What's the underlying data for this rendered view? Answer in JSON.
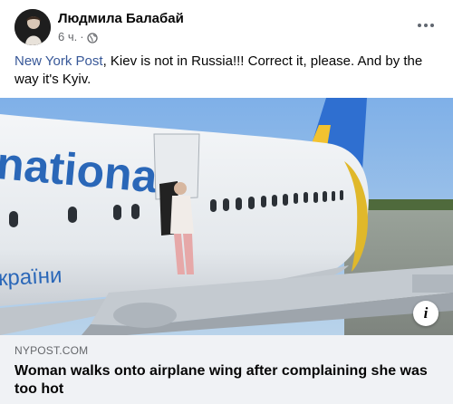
{
  "post": {
    "author": "Людмила Балабай",
    "time": "6 ч.",
    "separator": "·",
    "audience_icon": "globe-icon",
    "menu_icon": "more-options-icon",
    "text": {
      "link": "New York Post",
      "rest": ", Kiev is not in Russia!!! Correct it, please. And by the way it's Kyiv."
    }
  },
  "media": {
    "fuselage_text_top": "national",
    "fuselage_text_bottom": "країни",
    "info_icon": "info-icon",
    "info_label": "i"
  },
  "link_preview": {
    "domain": "NYPOST.COM",
    "headline": "Woman walks onto airplane wing after complaining she was too hot"
  },
  "colors": {
    "link": "#385898",
    "secondary_text": "#65676b",
    "preview_bg": "#f0f2f5",
    "tail_blue": "#2f6fd0",
    "tail_yellow": "#f2c230"
  }
}
